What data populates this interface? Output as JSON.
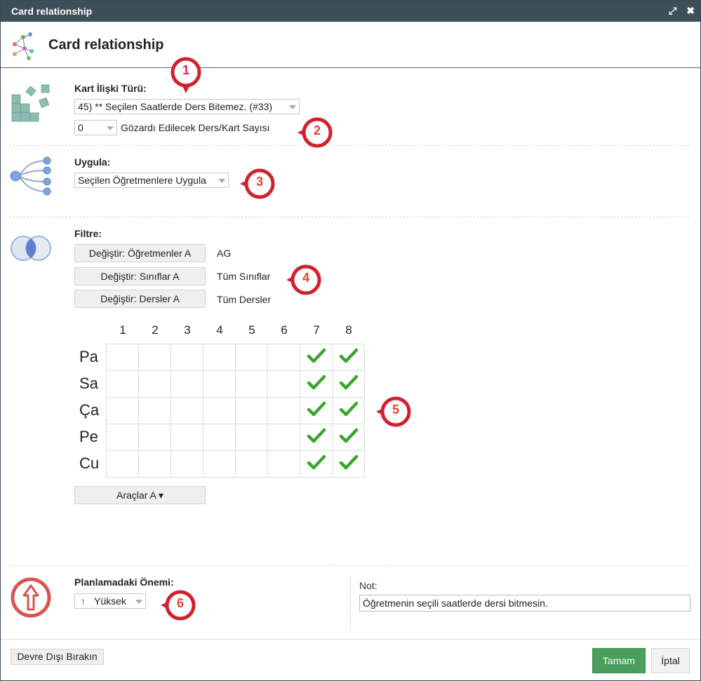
{
  "window": {
    "title": "Card relationship"
  },
  "header": {
    "title": "Card relationship"
  },
  "relation": {
    "type_label": "Kart İlişki Türü:",
    "type_value": "45) ** Seçilen Saatlerde Ders Bitemez. (#33)",
    "ignore_value": "0",
    "ignore_label": "Gözardı Edilecek Ders/Kart Sayısı"
  },
  "apply": {
    "label": "Uygula:",
    "value": "Seçilen Öğretmenlere Uygula"
  },
  "filter": {
    "label": "Filtre:",
    "rows": [
      {
        "button": "Değiştir: Öğretmenler A",
        "value": "AG"
      },
      {
        "button": "Değiştir: Sınıflar A",
        "value": "Tüm Sınıflar"
      },
      {
        "button": "Değiştir: Dersler A",
        "value": "Tüm Dersler"
      }
    ]
  },
  "grid": {
    "columns": [
      "1",
      "2",
      "3",
      "4",
      "5",
      "6",
      "7",
      "8"
    ],
    "rows": [
      "Pa",
      "Sa",
      "Ça",
      "Pe",
      "Cu"
    ],
    "checked_columns": [
      "7",
      "8"
    ]
  },
  "tools": {
    "label": "Araçlar A ▾"
  },
  "priority": {
    "label": "Planlamadaki Önemi:",
    "value": "Yüksek"
  },
  "note": {
    "label": "Not:",
    "value": "Öğretmenin seçili saatlerde dersi bitmesin."
  },
  "footer": {
    "disable": "Devre Dışı Bırakın",
    "ok": "Tamam",
    "cancel": "İptal"
  },
  "badges": [
    "1",
    "2",
    "3",
    "4",
    "5",
    "6"
  ],
  "colors": {
    "titlebar": "#3d4f58",
    "ok": "#4a9e5c",
    "badge": "#d0212e",
    "check": "#3aa52c",
    "priority": "#d9534f"
  }
}
